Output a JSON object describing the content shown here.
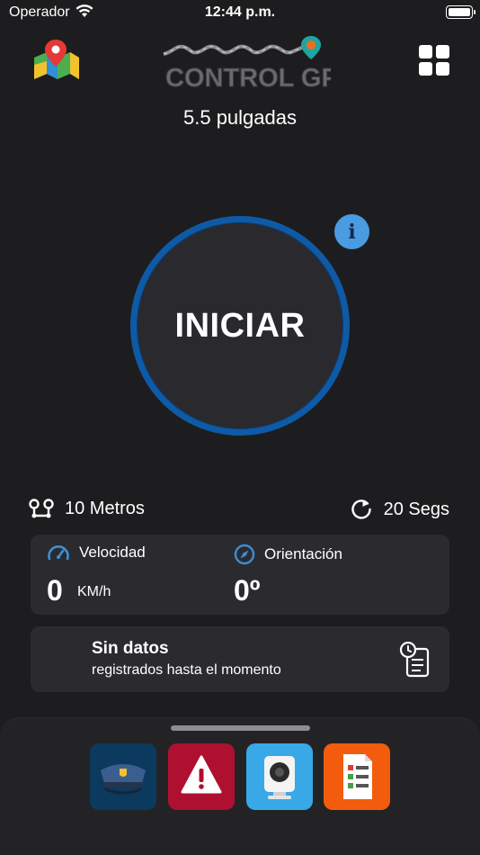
{
  "status_bar": {
    "carrier": "Operador",
    "time": "12:44 p.m."
  },
  "header": {
    "logo_text": "CONTROL GPS",
    "map_icon": "map-pin-icon",
    "menu_icon": "grid-icon",
    "screen_size_label": "5.5 pulgadas"
  },
  "start": {
    "label": "INICIAR",
    "info_icon": "info-icon",
    "ring_color": "#0e5aa7"
  },
  "metrics": {
    "distance": "10 Metros",
    "interval": "20 Segs"
  },
  "telemetry": {
    "speed_label": "Velocidad",
    "speed_value": "0",
    "speed_unit": "KM/h",
    "orientation_label": "Orientación",
    "orientation_value": "0º"
  },
  "records": {
    "title": "Sin datos",
    "subtitle": "registrados hasta el momento"
  },
  "bottom_apps": [
    {
      "icon": "police-cap-icon",
      "color": "#0b3a5e"
    },
    {
      "icon": "alert-icon",
      "color": "#b01030"
    },
    {
      "icon": "camera-icon",
      "color": "#38a8e6"
    },
    {
      "icon": "checklist-icon",
      "color": "#f25c0c"
    }
  ]
}
